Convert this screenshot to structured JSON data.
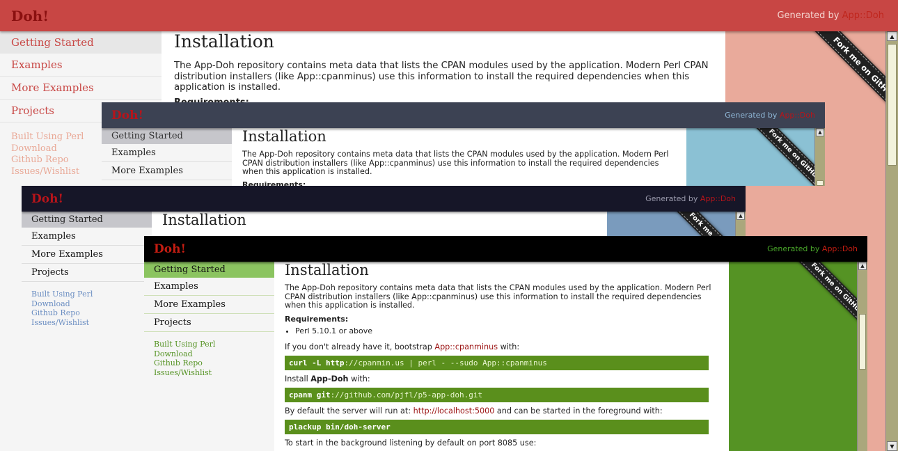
{
  "app": {
    "logo": "Doh!",
    "generated_prefix": "Generated by",
    "generated_link": "App::Doh"
  },
  "nav": [
    "Getting Started",
    "Examples",
    "More Examples",
    "Projects"
  ],
  "links": [
    "Built Using Perl",
    "Download",
    "Github Repo",
    "Issues/Wishlist"
  ],
  "ribbon": "Fork me on GitHub",
  "content": {
    "title": "Installation",
    "intro": "The App-Doh repository contains meta data that lists the CPAN modules used by the application. Modern Perl CPAN distribution installers (like App::cpanminus) use this information to install the required dependencies when this application is installed.",
    "requirements_label": "Requirements:",
    "requirements": [
      "Perl 5.10.1 or above"
    ],
    "bootstrap_prefix": "If you don't already have it, bootstrap",
    "bootstrap_link": "App::cpanminus",
    "bootstrap_suffix": "with:",
    "cmd1_kw": "curl -L http",
    "cmd1_rest": "://cpanmin.us | perl - --sudo App::cpanminus",
    "install_prefix": "Install",
    "install_name": "App-Doh",
    "install_suffix": "with:",
    "cmd2_kw": "cpanm git",
    "cmd2_rest": "://github.com/pjfl/p5-app-doh.git",
    "server_prefix": "By default the server will run at:",
    "server_link": "http://localhost:5000",
    "server_suffix": "and can be started in the foreground with:",
    "cmd3": "plackup bin/doh-server",
    "background_text": "To start in the background listening by default on port 8085 use:"
  },
  "themes": {
    "red": {
      "header_bg": "#c84644",
      "logo": "#8b1010",
      "gen_text": "#f4d4cf",
      "rail_bg": "#e9aa9b"
    },
    "slate": {
      "header_bg": "#3c4253",
      "logo": "#b8141a",
      "gen_text": "#8fb7d6",
      "rail_bg": "#8bc1d4"
    },
    "navy": {
      "header_bg": "#161628",
      "logo": "#b8141a",
      "gen_text": "#9c9cae",
      "rail_bg": "#7a9bbd"
    },
    "green": {
      "header_bg": "#000000",
      "logo": "#c41d12",
      "gen_text": "#4aa82a",
      "rail_bg": "#559324"
    }
  }
}
